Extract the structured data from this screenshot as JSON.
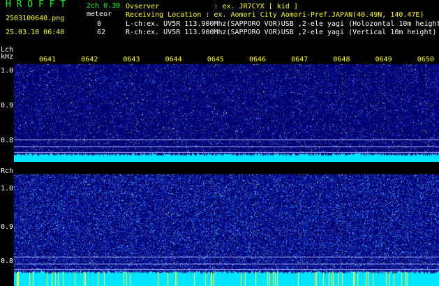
{
  "header": {
    "app_title": "H R O F F T",
    "channel_mode": "2ch 0.30",
    "filename": "2503100640.png",
    "meteor_label": "meteor",
    "datetime": "25.03.10 06:40",
    "lch_count": "0",
    "rch_count": "62",
    "info_lines": [
      "Ovserver             : ex. JR7CYX [ kid ]",
      "Receiving Location : ex. Aomori City Aomori-Pref.JAPAN(40.49N, 140.47E)",
      "L-ch:ex. UV5R 113.900Mhz(SAPPORO VOR)USB ,2-ele yagi (Holozontal 10m height)",
      "R-ch:ex. UV5R 113.900Mhz(SAPPORO VOR)USB ,2-ele yagi (Vertical 10m height)"
    ]
  },
  "lch": {
    "label": "Lch",
    "unit": "kHz",
    "time_ticks": [
      "0641",
      "0642",
      "0643",
      "0644",
      "0645",
      "0646",
      "0647",
      "0648",
      "0649",
      "0650"
    ],
    "freq_ticks": [
      "1.0",
      "0.9",
      "0.8"
    ]
  },
  "rch": {
    "label": "Rch",
    "freq_ticks": [
      "1.0",
      "0.9",
      "0.8"
    ]
  },
  "colors": {
    "background": "#000000",
    "header_text": "#ffffff",
    "title": "#00ff00",
    "ticks": "#ffff00",
    "noise_dark": "#00006e",
    "noise_bright": "#2a5cff",
    "baseline": "#00ffff"
  }
}
